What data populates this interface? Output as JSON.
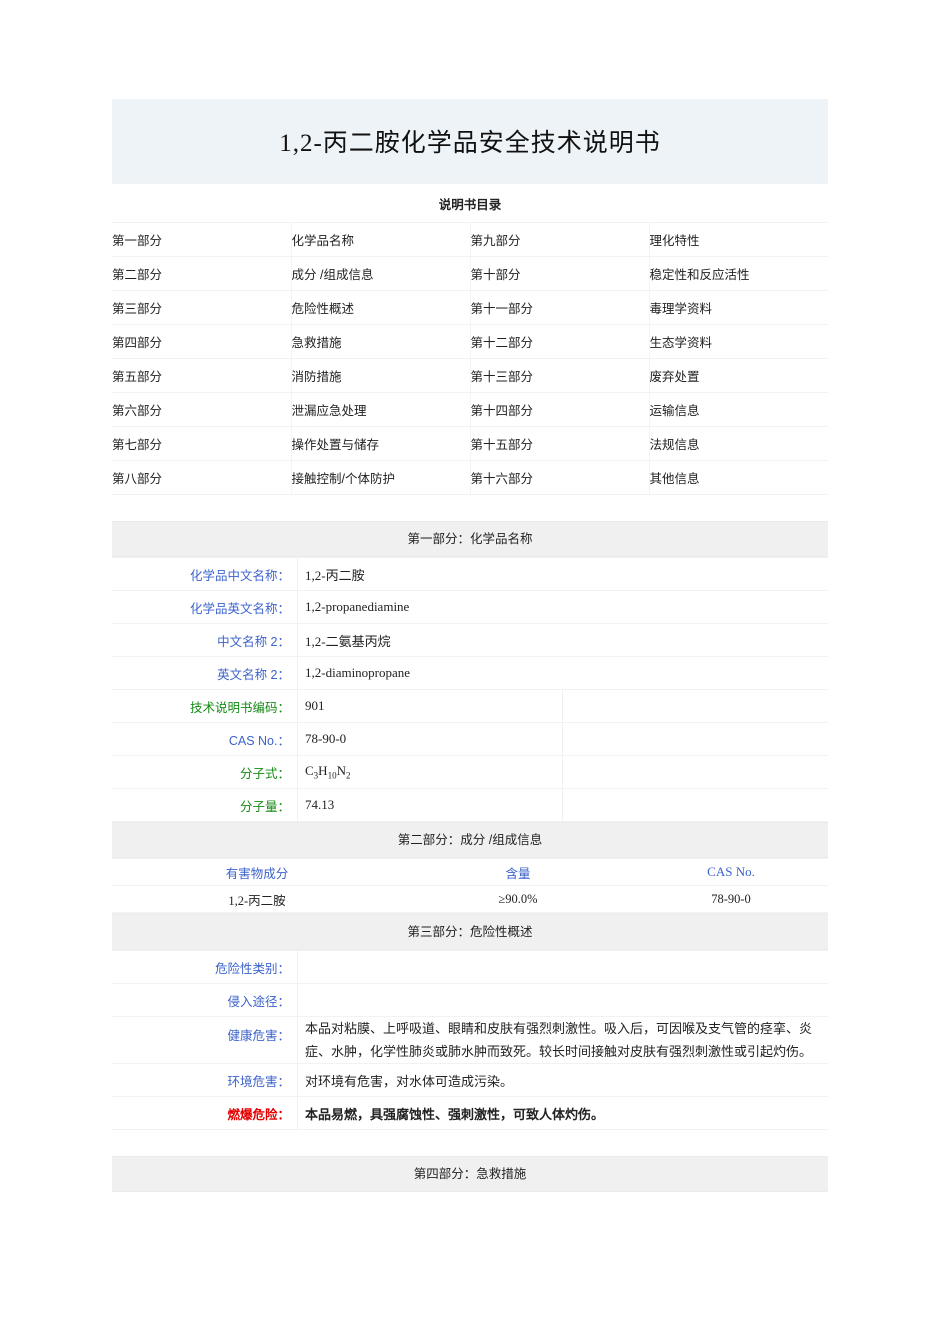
{
  "document": {
    "title": "1,2-丙二胺化学品安全技术说明书",
    "toc_title": "说明书目录"
  },
  "toc": {
    "rows": [
      {
        "left_no": "第一部分",
        "left_name": "化学品名称",
        "right_no": "第九部分",
        "right_name": "理化特性"
      },
      {
        "left_no": "第二部分",
        "left_name": "成分 /组成信息",
        "right_no": "第十部分",
        "right_name": "稳定性和反应活性"
      },
      {
        "left_no": "第三部分",
        "left_name": "危险性概述",
        "right_no": "第十一部分",
        "right_name": "毒理学资料"
      },
      {
        "left_no": "第四部分",
        "left_name": "急救措施",
        "right_no": "第十二部分",
        "right_name": "生态学资料"
      },
      {
        "left_no": "第五部分",
        "left_name": "消防措施",
        "right_no": "第十三部分",
        "right_name": "废弃处置"
      },
      {
        "left_no": "第六部分",
        "left_name": "泄漏应急处理",
        "right_no": "第十四部分",
        "right_name": "运输信息"
      },
      {
        "left_no": "第七部分",
        "left_name": "操作处置与储存",
        "right_no": "第十五部分",
        "right_name": "法规信息"
      },
      {
        "left_no": "第八部分",
        "left_name": "接触控制/个体防护",
        "right_no": "第十六部分",
        "right_name": "其他信息"
      }
    ]
  },
  "part1": {
    "header": "第一部分：化学品名称",
    "labels": {
      "cn_name": "化学品中文名称：",
      "en_name": "化学品英文名称：",
      "cn_name2": "中文名称 2：",
      "en_name2": "英文名称 2：",
      "doc_code": "技术说明书编码：",
      "cas_no": "CAS No.：",
      "formula": "分子式：",
      "mol_weight": "分子量："
    },
    "values": {
      "cn_name": "1,2-丙二胺",
      "en_name": "1,2-propanediamine",
      "cn_name2": "1,2-二氨基丙烷",
      "en_name2": "1,2-diaminopropane",
      "doc_code": "901",
      "cas_no": "78-90-0",
      "formula_base1": "C",
      "formula_sub1": "3",
      "formula_base2": "H",
      "formula_sub2": "10",
      "formula_base3": "N",
      "formula_sub3": "2",
      "mol_weight": "74.13"
    }
  },
  "part2": {
    "header": "第二部分：成分 /组成信息",
    "columns": [
      "有害物成分",
      "含量",
      "CAS No."
    ],
    "row": [
      "1,2-丙二胺",
      "≥90.0%",
      "78-90-0"
    ]
  },
  "part3": {
    "header": "第三部分：危险性概述",
    "labels": {
      "hazard_class": "危险性类别：",
      "invasion_route": "侵入途径：",
      "health_hazard": "健康危害：",
      "env_hazard": "环境危害：",
      "fire_hazard": "燃爆危险："
    },
    "values": {
      "hazard_class": "",
      "invasion_route": "",
      "health_hazard": "本品对粘膜、上呼吸道、眼睛和皮肤有强烈刺激性。吸入后，可因喉及支气管的痉挛、炎症、水肿，化学性肺炎或肺水肿而致死。较长时间接触对皮肤有强烈刺激性或引起灼伤。",
      "env_hazard": "对环境有危害，对水体可造成污染。",
      "fire_hazard": "本品易燃，具强腐蚀性、强刺激性，可致人体灼伤。"
    }
  },
  "part4": {
    "header": "第四部分：急救措施"
  },
  "colors": {
    "title_band": "#eef3f7",
    "section_bar": "#f0f0f0",
    "label_blue": "#3c63cc",
    "label_green": "#158a15",
    "warning_red": "#e60000"
  }
}
